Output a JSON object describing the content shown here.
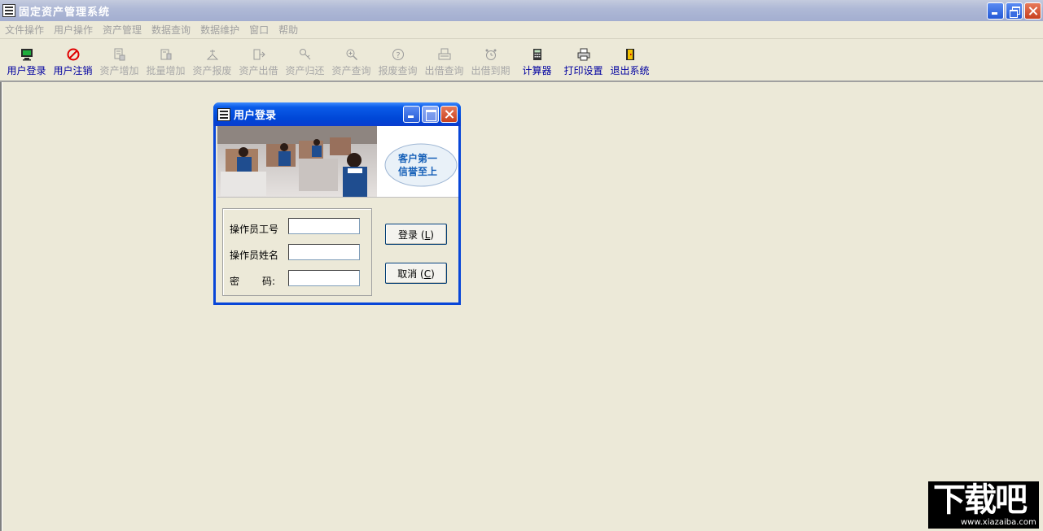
{
  "window": {
    "title": "固定资产管理系统"
  },
  "menubar": {
    "items": [
      {
        "label": "文件操作"
      },
      {
        "label": "用户操作"
      },
      {
        "label": "资产管理"
      },
      {
        "label": "数据查询"
      },
      {
        "label": "数据维护"
      },
      {
        "label": "窗口"
      },
      {
        "label": "帮助"
      }
    ]
  },
  "toolbar": {
    "items": [
      {
        "label": "用户登录",
        "icon": "monitor-icon",
        "enabled": true
      },
      {
        "label": "用户注销",
        "icon": "logout-icon",
        "enabled": true
      },
      {
        "label": "资产增加",
        "icon": "asset-add-icon",
        "enabled": false
      },
      {
        "label": "批量增加",
        "icon": "batch-add-icon",
        "enabled": false
      },
      {
        "label": "资产报废",
        "icon": "scrap-icon",
        "enabled": false
      },
      {
        "label": "资产出借",
        "icon": "lend-icon",
        "enabled": false
      },
      {
        "label": "资产归还",
        "icon": "key-icon",
        "enabled": false
      },
      {
        "label": "资产查询",
        "icon": "magnifier-icon",
        "enabled": false
      },
      {
        "label": "报废查询",
        "icon": "help-icon",
        "enabled": false
      },
      {
        "label": "出借查询",
        "icon": "tray-icon",
        "enabled": false
      },
      {
        "label": "出借到期",
        "icon": "alarm-clock-icon",
        "enabled": false
      },
      {
        "label": "计算器",
        "icon": "calculator-icon",
        "enabled": true
      },
      {
        "label": "打印设置",
        "icon": "printer-icon",
        "enabled": true
      },
      {
        "label": "退出系统",
        "icon": "exit-door-icon",
        "enabled": true
      }
    ]
  },
  "dialog": {
    "title": "用户登录",
    "banner": {
      "slogan_line1": "客户第一",
      "slogan_line2": "信誉至上"
    },
    "fields": {
      "operator_id_label": "操作员工号",
      "operator_id_value": "",
      "operator_name_label": "操作员姓名",
      "operator_name_value": "",
      "password_label_a": "密",
      "password_label_b": "码:",
      "password_value": ""
    },
    "buttons": {
      "login_text": "登录",
      "login_accel_open": "(",
      "login_accel": "L",
      "login_accel_close": ")",
      "cancel_text": "取消",
      "cancel_accel_open": "(",
      "cancel_accel": "C",
      "cancel_accel_close": ")"
    }
  },
  "watermark": {
    "main": "下载吧",
    "sub": "www.xiazaiba.com"
  },
  "colors": {
    "desktop_bg": "#ECE9D8",
    "enabled_text": "#0000A0",
    "disabled_text": "#A8A8A8",
    "dialog_title_blue": "#0046D6",
    "slogan_blue": "#1660B8"
  }
}
